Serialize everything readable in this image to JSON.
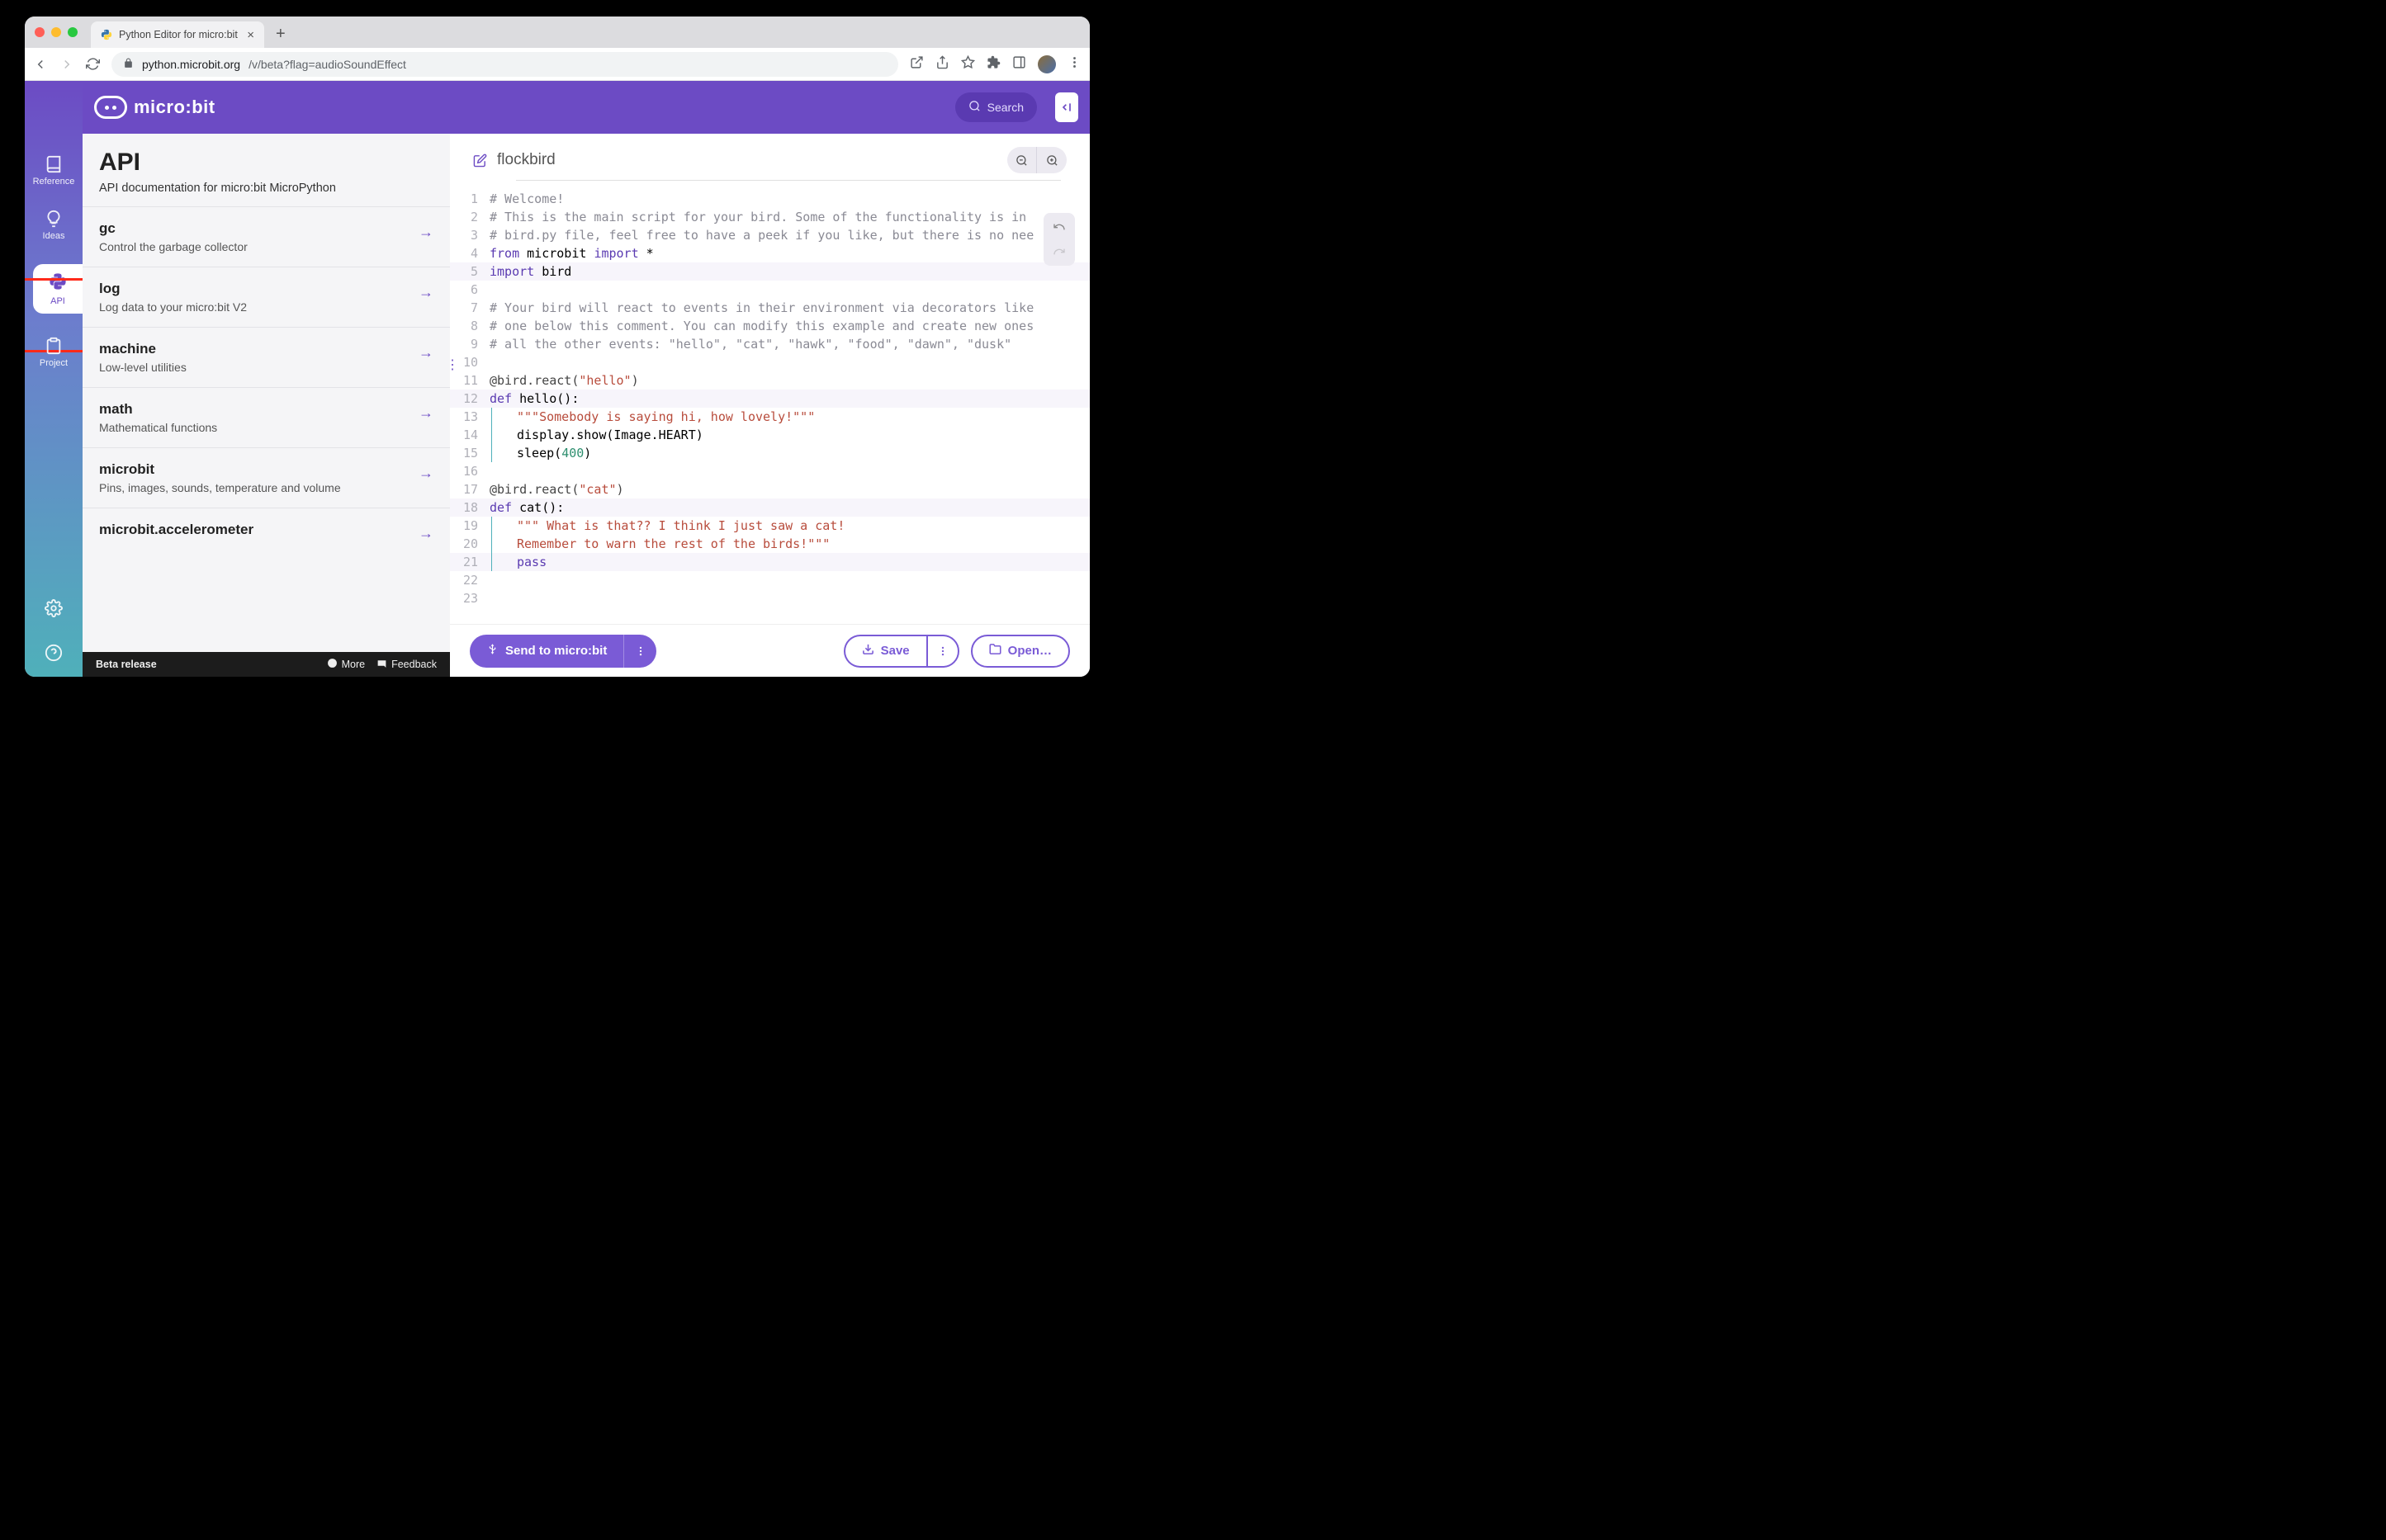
{
  "browser": {
    "tab_title": "Python Editor for micro:bit",
    "url_domain": "python.microbit.org",
    "url_path": "/v/beta?flag=audioSoundEffect"
  },
  "header": {
    "brand": "micro:bit",
    "search_label": "Search"
  },
  "rail": {
    "items": [
      {
        "label": "Reference"
      },
      {
        "label": "Ideas"
      },
      {
        "label": "API",
        "active": true
      },
      {
        "label": "Project"
      }
    ]
  },
  "panel": {
    "title": "API",
    "subtitle": "API documentation for micro:bit MicroPython",
    "items": [
      {
        "name": "gc",
        "desc": "Control the garbage collector"
      },
      {
        "name": "log",
        "desc": "Log data to your micro:bit V2"
      },
      {
        "name": "machine",
        "desc": "Low-level utilities"
      },
      {
        "name": "math",
        "desc": "Mathematical functions"
      },
      {
        "name": "microbit",
        "desc": "Pins, images, sounds, temperature and volume"
      },
      {
        "name": "microbit.accelerometer",
        "desc": ""
      }
    ]
  },
  "beta_bar": {
    "label": "Beta release",
    "more": "More",
    "feedback": "Feedback"
  },
  "editor": {
    "project_name": "flockbird",
    "lines": [
      {
        "n": 1,
        "kind": "comment",
        "text": "# Welcome!"
      },
      {
        "n": 2,
        "kind": "comment",
        "text": "# This is the main script for your bird. Some of the functionality is in"
      },
      {
        "n": 3,
        "kind": "comment",
        "text": "# bird.py file, feel free to have a peek if you like, but there is no nee"
      },
      {
        "n": 4,
        "kind": "import1",
        "a": "from",
        "b": "microbit",
        "c": "import",
        "d": "*"
      },
      {
        "n": 5,
        "kind": "import2",
        "a": "import",
        "b": "bird",
        "hl": true
      },
      {
        "n": 6,
        "kind": "blank",
        "text": ""
      },
      {
        "n": 7,
        "kind": "comment",
        "text": "# Your bird will react to events in their environment via decorators like"
      },
      {
        "n": 8,
        "kind": "comment",
        "text": "# one below this comment. You can modify this example and create new ones"
      },
      {
        "n": 9,
        "kind": "comment",
        "text": "# all the other events: \"hello\", \"cat\", \"hawk\", \"food\", \"dawn\", \"dusk\""
      },
      {
        "n": 10,
        "kind": "blank",
        "text": ""
      },
      {
        "n": 11,
        "kind": "deco",
        "pre": "@bird.react(",
        "str": "\"hello\"",
        "post": ")"
      },
      {
        "n": 12,
        "kind": "def",
        "kw": "def",
        "name": "hello():",
        "hl": true
      },
      {
        "n": 13,
        "kind": "docstr",
        "text": "\"\"\"Somebody is saying hi, how lovely!\"\"\"",
        "indent": true
      },
      {
        "n": 14,
        "kind": "code",
        "text": "display.show(Image.HEART)",
        "indent": true
      },
      {
        "n": 15,
        "kind": "call",
        "pre": "sleep(",
        "num": "400",
        "post": ")",
        "indent": true
      },
      {
        "n": 16,
        "kind": "blank",
        "text": ""
      },
      {
        "n": 17,
        "kind": "deco",
        "pre": "@bird.react(",
        "str": "\"cat\"",
        "post": ")"
      },
      {
        "n": 18,
        "kind": "def",
        "kw": "def",
        "name": "cat():",
        "hl": true
      },
      {
        "n": 19,
        "kind": "docstr",
        "text": "\"\"\" What is that?? I think I just saw a cat!",
        "indent": true
      },
      {
        "n": 20,
        "kind": "docstr",
        "text": "Remember to warn the rest of the birds!\"\"\"",
        "indent": true
      },
      {
        "n": 21,
        "kind": "kwline",
        "kw": "pass",
        "indent": true,
        "hl": true
      },
      {
        "n": 22,
        "kind": "blank",
        "text": ""
      },
      {
        "n": 23,
        "kind": "blank",
        "text": ""
      }
    ]
  },
  "bottom": {
    "send": "Send to micro:bit",
    "save": "Save",
    "open": "Open…"
  }
}
